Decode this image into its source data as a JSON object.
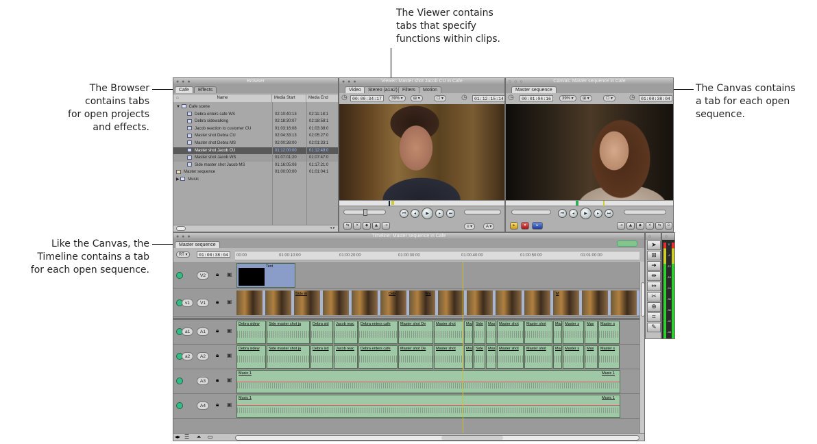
{
  "callouts": {
    "viewer": [
      "The Viewer contains",
      "tabs that specify",
      "functions within clips."
    ],
    "browser": [
      "The Browser",
      "contains tabs",
      "for open projects",
      "and effects."
    ],
    "canvas": [
      "The Canvas contains",
      "a tab for each open",
      "sequence."
    ],
    "timeline": [
      "Like the Canvas, the",
      "Timeline contains a tab",
      "for each open sequence."
    ]
  },
  "browser": {
    "title": "Browser",
    "tabs": [
      "Cafe",
      "Effects"
    ],
    "columns": [
      "Name",
      "Media Start",
      "Media End"
    ],
    "rows": [
      {
        "name": "Cafe scene",
        "start": "",
        "end": "",
        "kind": "folder",
        "indent": 0
      },
      {
        "name": "Debra enters cafe WS",
        "start": "02:10:40:13",
        "end": "02:11:18:1",
        "kind": "clip",
        "indent": 1
      },
      {
        "name": "Debra sidewalking",
        "start": "02:18:30:07",
        "end": "02:18:58:1",
        "kind": "clip",
        "indent": 1
      },
      {
        "name": "Jacob reaction to customer CU",
        "start": "01:03:16:08",
        "end": "01:03:38:0",
        "kind": "clip",
        "indent": 1
      },
      {
        "name": "Master shot Debra CU",
        "start": "02:04:33:13",
        "end": "02:05:27:0",
        "kind": "clip",
        "indent": 1
      },
      {
        "name": "Master shot Debra MS",
        "start": "02:00:38:00",
        "end": "02:01:33:1",
        "kind": "clip",
        "indent": 1
      },
      {
        "name": "Master shot Jacob CU",
        "start": "01:12:00:00",
        "end": "01:12:49:0",
        "kind": "clip",
        "indent": 1,
        "selected": true
      },
      {
        "name": "Master shot Jacob WS",
        "start": "01:07:01:20",
        "end": "01:07:47:0",
        "kind": "clip",
        "indent": 1,
        "alt": true
      },
      {
        "name": "Side master shot Jacob MS",
        "start": "01:16:05:08",
        "end": "01:17:21:0",
        "kind": "clip",
        "indent": 1
      },
      {
        "name": "Master sequence",
        "start": "01:00:00:00",
        "end": "01:01:04:1",
        "kind": "seq",
        "indent": 0
      },
      {
        "name": "Music",
        "start": "",
        "end": "",
        "kind": "folder",
        "indent": 0
      }
    ]
  },
  "viewer": {
    "title": "Viewer: Master shot Jacob CU in Cafe",
    "tabs": [
      "Video",
      "Stereo (a1a2)",
      "Filters",
      "Motion"
    ],
    "timecode_left": "00:00:34:17",
    "zoom": "39%",
    "timecode_right": "01:12:15:14"
  },
  "canvas": {
    "title": "Canvas: Master sequence in Cafe",
    "tab": "Master sequence",
    "timecode_left": "00:01:04:16",
    "zoom": "39%",
    "timecode_right": "01:00:38:04"
  },
  "timeline": {
    "title": "Timeline: Master sequence in Cafe",
    "tab": "Master sequence",
    "rt": "RT",
    "current_timecode": "01:00:38:04",
    "ruler": [
      "00:00",
      "01:00:10:00",
      "01:00:20:00",
      "01:00:30:00",
      "01:00:40:00",
      "01:00:50:00",
      "01:01:00:00"
    ],
    "video_tracks": [
      {
        "src": "",
        "dst": "V2"
      },
      {
        "src": "v1",
        "dst": "V1"
      }
    ],
    "audio_tracks": [
      {
        "src": "a1",
        "dst": "A1"
      },
      {
        "src": "a2",
        "dst": "A2"
      },
      {
        "src": "",
        "dst": "A3"
      },
      {
        "src": "",
        "dst": "A4"
      }
    ],
    "v2_clip": "Text",
    "v1_labels": [
      "Side m",
      "Deb",
      "Ma",
      "M"
    ],
    "audio_clips": [
      {
        "name": "Debra sidew",
        "w": 44
      },
      {
        "name": "Side master shot ja",
        "w": 64
      },
      {
        "name": "Debra sid",
        "w": 34
      },
      {
        "name": "Jacob reac",
        "w": 36
      },
      {
        "name": "Debra enters cafe",
        "w": 58
      },
      {
        "name": "Master shot De",
        "w": 52
      },
      {
        "name": "Master shot",
        "w": 44
      },
      {
        "name": "Mas",
        "w": 14
      },
      {
        "name": "Side",
        "w": 18
      },
      {
        "name": "Mas",
        "w": 16
      },
      {
        "name": "Master shot",
        "w": 40
      },
      {
        "name": "Master shot",
        "w": 42
      },
      {
        "name": "Mas",
        "w": 14
      },
      {
        "name": "Master s",
        "w": 32
      },
      {
        "name": "Mas",
        "w": 20
      },
      {
        "name": "Master s",
        "w": 32
      }
    ],
    "music_clip": "Music 1"
  },
  "meter_labels": [
    "0",
    "-6",
    "-12",
    "-18",
    "-24",
    "-30",
    "-36",
    "-42",
    "-48"
  ]
}
